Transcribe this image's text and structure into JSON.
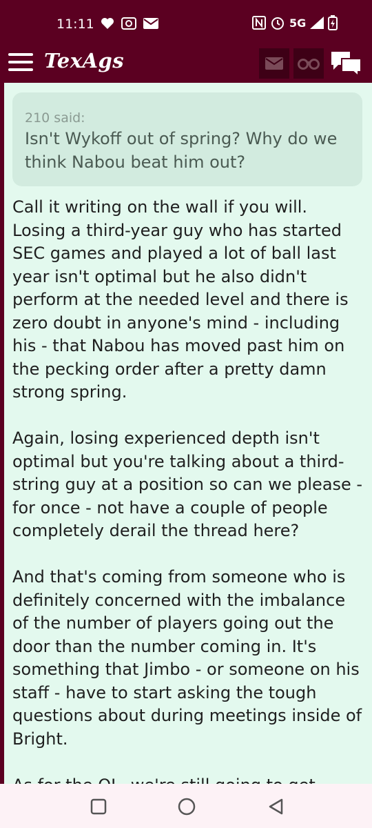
{
  "status": {
    "time": "11:11",
    "network": "5G",
    "icons": [
      "heart-icon",
      "radio-icon",
      "mail-icon",
      "nfc-icon",
      "alarm-icon",
      "signal-icon",
      "battery-charging-icon"
    ]
  },
  "appbar": {
    "brand": "TexAgs",
    "icons": [
      "menu-icon",
      "mail-icon",
      "binoculars-icon",
      "chat-icon"
    ]
  },
  "post": {
    "quote": {
      "author": "210 said:",
      "text": "Isn't Wykoff out of spring? Why do we think Nabou beat him out?"
    },
    "paragraphs": [
      "Call it writing on the wall if you will. Losing a third-year guy who has started SEC games and played a lot of ball last year isn't optimal but he also didn't perform at the needed level and there is zero doubt in anyone's mind - including his - that Nabou has moved past him on the pecking order after a pretty damn strong spring.",
      "Again, losing experienced depth isn't optimal but you're talking about a third-string guy at a position so can we please - for once - not have a couple of people completely derail the thread here?",
      "And that's coming from someone who is definitely concerned with the imbalance of the number of players going out the door than the number coming in. It's something that Jimbo - or someone on his staff - have to start asking the tough questions about during meetings inside of Bright.",
      "As for the OL, we're still going to get..."
    ]
  },
  "colors": {
    "maroon": "#5b0021",
    "content_bg": "#e3f9ee",
    "quote_bg": "#d2ebdf"
  },
  "navbar": {
    "icons": [
      "recent-apps-icon",
      "home-icon",
      "back-icon"
    ]
  }
}
